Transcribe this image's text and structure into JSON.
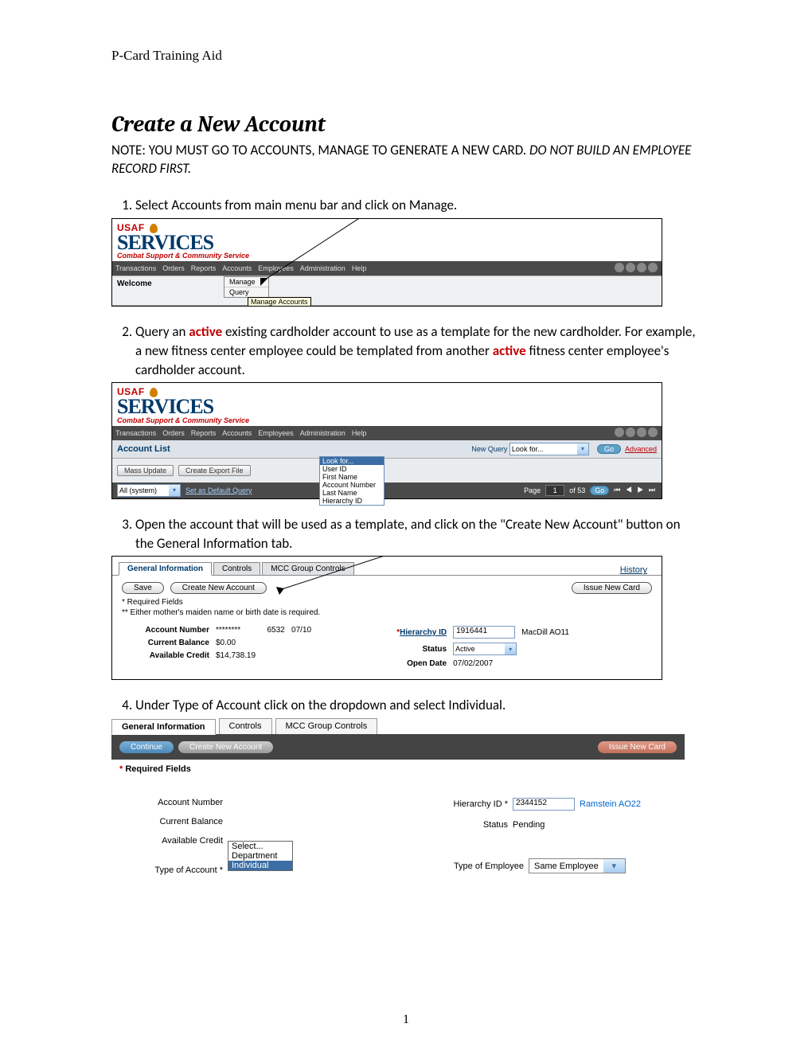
{
  "header": "P-Card Training Aid",
  "title": "Create a New Account",
  "note_pre": "NOTE: YOU MUST GO TO ACCOUNTS, MANAGE TO GENERATE A NEW CARD.  ",
  "note_emph": "DO NOT BUILD AN EMPLOYEE RECORD FIRST.",
  "steps": {
    "s1": "Select Accounts from main menu bar and click on Manage.",
    "s2_a": "Query an ",
    "s2_active": "active",
    "s2_b": " existing cardholder account to use as a template for the new cardholder. For example, a new fitness center employee could be templated from another ",
    "s2_c": " fitness center employee's cardholder account.",
    "s3": "Open the account that will be used as a template, and click on the \"Create New Account\" button on the General Information tab.",
    "s4": "Under Type of Account click on the dropdown and select Individual."
  },
  "brand": {
    "usaf": "USAF",
    "services": "SERVICES",
    "combat": "Combat Support & Community Service"
  },
  "menu": {
    "items": [
      "Transactions",
      "Orders",
      "Reports",
      "Accounts",
      "Employees",
      "Administration",
      "Help"
    ]
  },
  "shot1": {
    "welcome": "Welcome",
    "dd1": "Manage",
    "dd2": "Query",
    "tooltip": "Manage Accounts"
  },
  "shot2": {
    "title": "Account List",
    "newquery": "New Query",
    "lookfor": "Look for...",
    "go": "Go",
    "advanced": "Advanced",
    "options": [
      "Look for...",
      "User ID",
      "First Name",
      "Account Number",
      "Last Name",
      "Hierarchy ID"
    ],
    "mass": "Mass Update",
    "export": "Create Export File",
    "all": "All (system)",
    "setdefault": "Set as Default Query",
    "page": "Page",
    "pageval": "1",
    "of": "of 53",
    "gobtn": "Go"
  },
  "shot3": {
    "tabs": [
      "General Information",
      "Controls",
      "MCC Group Controls"
    ],
    "history": "History",
    "save": "Save",
    "createnew": "Create New Account",
    "issuenew": "Issue New Card",
    "req1": "* Required Fields",
    "req2": "** Either mother's maiden name or birth date is required.",
    "acctnum_lbl": "Account Number",
    "acctnum_val": "********            6532   07/10",
    "curbal_lbl": "Current Balance",
    "curbal_val": "$0.00",
    "avail_lbl": "Available Credit",
    "avail_val": "$14,738.19",
    "hier_lbl": "Hierarchy ID",
    "hier_val": "1916441",
    "hier_loc": "MacDill AO11",
    "status_lbl": "Status",
    "status_val": "Active",
    "open_lbl": "Open Date",
    "open_val": "07/02/2007"
  },
  "shot4": {
    "tabs": [
      "General Information",
      "Controls",
      "MCC Group Controls"
    ],
    "continue": "Continue",
    "createnew": "Create New Account",
    "issuenew": "Issue New Card",
    "req": "* Required Fields",
    "acctnum_lbl": "Account Number",
    "curbal_lbl": "Current Balance",
    "avail_lbl": "Available Credit",
    "type_acct_lbl": "Type of Account *",
    "dd_opts": [
      "Select...",
      "Department",
      "Individual"
    ],
    "hier_lbl": "Hierarchy ID *",
    "hier_val": "2344152",
    "hier_loc": "Ramstein AO22",
    "status_lbl": "Status",
    "status_val": "Pending",
    "type_emp_lbl": "Type of Employee",
    "type_emp_val": "Same Employee"
  },
  "page_number": "1"
}
